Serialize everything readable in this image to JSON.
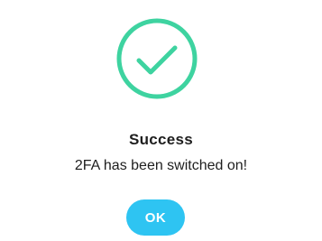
{
  "dialog": {
    "icon": "check-circle-icon",
    "title": "Success",
    "message": "2FA has been switched on!",
    "ok_label": "OK"
  },
  "colors": {
    "success_green": "#3ed3a0",
    "button_blue": "#2ec4f2",
    "text_dark": "#1e1e1e",
    "background": "#ffffff"
  }
}
